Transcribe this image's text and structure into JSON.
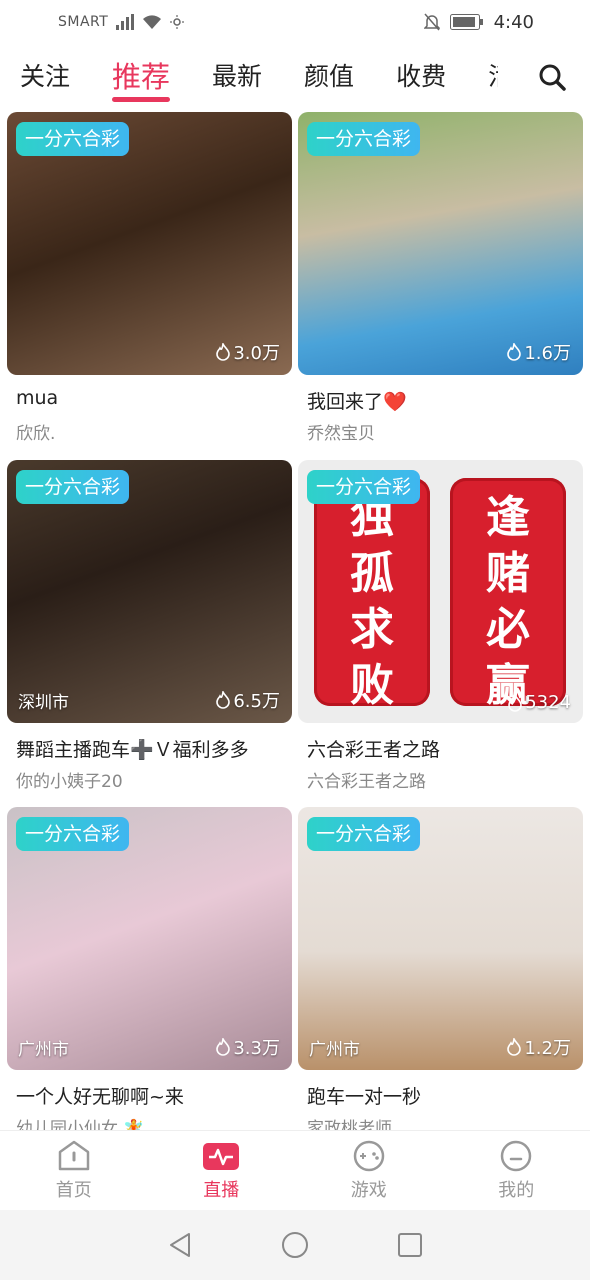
{
  "status_bar": {
    "carrier": "SMART",
    "time": "4:40"
  },
  "tabs": [
    {
      "label": "关注",
      "active": false
    },
    {
      "label": "推荐",
      "active": true
    },
    {
      "label": "最新",
      "active": false
    },
    {
      "label": "颜值",
      "active": false
    },
    {
      "label": "收费",
      "active": false
    },
    {
      "label": "活",
      "active": false
    }
  ],
  "search": {
    "icon": "search-icon"
  },
  "cards": [
    {
      "badge": "一分六合彩",
      "views": "3.0万",
      "city": "",
      "title": "mua",
      "host": "欣欣."
    },
    {
      "badge": "一分六合彩",
      "views": "1.6万",
      "city": "",
      "title": "我回来了❤️",
      "host": "乔然宝贝"
    },
    {
      "badge": "一分六合彩",
      "views": "6.5万",
      "city": "深圳市",
      "title": "舞蹈主播跑车➕Ｖ福利多多",
      "host": "你的小姨子20"
    },
    {
      "badge": "一分六合彩",
      "views": "5324",
      "city": "",
      "title": "六合彩王者之路",
      "host": "六合彩王者之路",
      "phone_left": [
        "独",
        "孤",
        "求",
        "败"
      ],
      "phone_right": [
        "逢",
        "赌",
        "必",
        "赢"
      ]
    },
    {
      "badge": "一分六合彩",
      "views": "3.3万",
      "city": "广州市",
      "title": "一个人好无聊啊~来",
      "host": "幼儿园小仙女.🧚"
    },
    {
      "badge": "一分六合彩",
      "views": "1.2万",
      "city": "广州市",
      "title": "跑车一对一秒",
      "host": "家政桃老师"
    }
  ],
  "bottom_nav": [
    {
      "label": "首页",
      "icon": "home-icon",
      "active": false
    },
    {
      "label": "直播",
      "icon": "live-icon",
      "active": true
    },
    {
      "label": "游戏",
      "icon": "gamepad-icon",
      "active": false
    },
    {
      "label": "我的",
      "icon": "profile-icon",
      "active": false
    }
  ],
  "colors": {
    "accent": "#e8375d",
    "badge_from": "#2ed2c9",
    "badge_to": "#3fb6f0"
  }
}
